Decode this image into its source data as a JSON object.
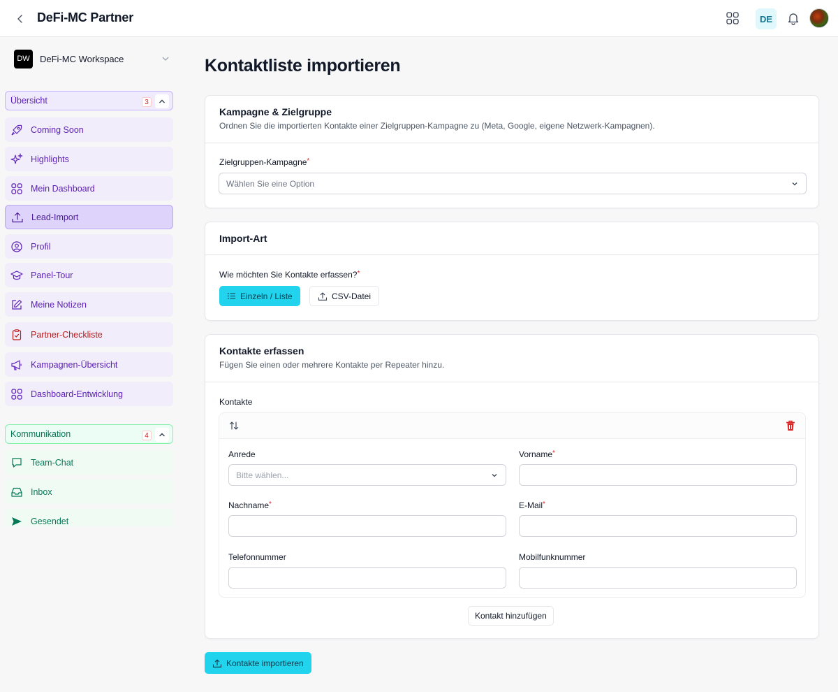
{
  "topbar": {
    "back_icon": "chevron-left-icon",
    "title": "DeFi-MC Partner",
    "apps_icon": "grid-icon",
    "language": "DE",
    "bell_icon": "bell-icon"
  },
  "sidebar": {
    "workspace": {
      "logo": "DW",
      "name": "DeFi-MC Workspace"
    },
    "groups": [
      {
        "label": "Übersicht",
        "count": "3",
        "items": [
          {
            "label": "Coming Soon",
            "icon": "rocket-icon"
          },
          {
            "label": "Highlights",
            "icon": "sparkles-icon"
          },
          {
            "label": "Mein Dashboard",
            "icon": "grid-icon"
          },
          {
            "label": "Lead-Import",
            "icon": "upload-icon",
            "active": true
          },
          {
            "label": "Profil",
            "icon": "user-circle-icon"
          },
          {
            "label": "Panel-Tour",
            "icon": "graduation-cap-icon"
          },
          {
            "label": "Meine Notizen",
            "icon": "pencil-square-icon"
          },
          {
            "label": "Partner-Checkliste",
            "icon": "clipboard-check-icon"
          },
          {
            "label": "Kampagnen-Übersicht",
            "icon": "megaphone-icon"
          },
          {
            "label": "Dashboard-Entwicklung",
            "icon": "grid-icon"
          }
        ]
      },
      {
        "label": "Kommunikation",
        "count": "4",
        "items": [
          {
            "label": "Team-Chat",
            "icon": "chat-bubble-icon"
          },
          {
            "label": "Inbox",
            "icon": "inbox-icon"
          },
          {
            "label": "Gesendet",
            "icon": "paper-airplane-icon"
          }
        ]
      }
    ]
  },
  "main": {
    "title": "Kontaktliste importieren",
    "campaign_card": {
      "title": "Kampagne & Zielgruppe",
      "description": "Ordnen Sie die importierten Kontakte einer Zielgruppen-Kampagne zu (Meta, Google, eigene Netzwerk-Kampagnen).",
      "field_label": "Zielgruppen-Kampagne",
      "placeholder": "Wählen Sie eine Option"
    },
    "import_card": {
      "title": "Import-Art",
      "question": "Wie möchten Sie Kontakte erfassen?",
      "option_list": "Einzeln / Liste",
      "option_csv": "CSV-Datei"
    },
    "contacts_card": {
      "title": "Kontakte erfassen",
      "description": "Fügen Sie einen oder mehrere Kontakte per Repeater hinzu.",
      "repeater_label": "Kontakte",
      "fields": {
        "salutation": "Anrede",
        "salutation_placeholder": "Bitte wählen...",
        "first_name": "Vorname",
        "last_name": "Nachname",
        "email": "E-Mail",
        "phone": "Telefonnummer",
        "mobile": "Mobilfunknummer"
      },
      "add_button": "Kontakt hinzufügen"
    },
    "submit_button": "Kontakte importieren"
  },
  "colors": {
    "primary": "#22d3ee",
    "group_purple": "#5b21b6",
    "group_green": "#047857",
    "danger": "#dc2626"
  }
}
